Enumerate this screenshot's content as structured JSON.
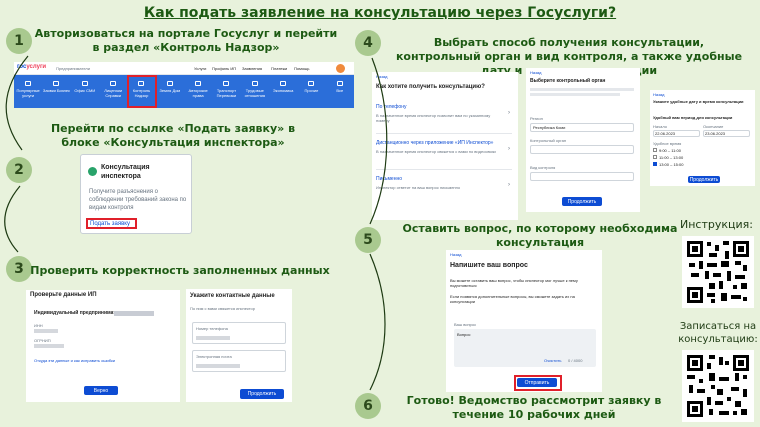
{
  "title": "Как подать заявление на консультацию через Госуслуги?",
  "steps": [
    {
      "num": "1",
      "text": "Авторизоваться на портале Госуслуг и перейти в раздел «Контроль Надзор»"
    },
    {
      "num": "2",
      "text": "Перейти по ссылке «Подать заявку» в блоке «Консультация инспектора»"
    },
    {
      "num": "3",
      "text": "Проверить корректность заполненных данных"
    },
    {
      "num": "4",
      "text": "Выбрать способ получения консультации, контрольный орган и вид контроля, а также удобные дату и время консультации"
    },
    {
      "num": "5",
      "text": "Оставить вопрос, по которому необходима консультация"
    },
    {
      "num": "6",
      "text": "Готово! Ведомство рассмотрит заявку в течение 10 рабочих дней"
    }
  ],
  "portal": {
    "logo_a": "гос",
    "logo_b": "услуги",
    "entity": "Предприниматели",
    "top_links": [
      "Услуги",
      "Профиль ИП",
      "Заявления",
      "Платежи",
      "Помощь"
    ],
    "nav": [
      "Популярные услуги",
      "Заявки Бизнес",
      "Офис СМИ",
      "Лицензии Справки",
      "Контроль Надзор",
      "Земля Дом",
      "Авторские права",
      "Транспорт Перевозки",
      "Трудовые отношения",
      "Экономика",
      "Прочие",
      "Все"
    ]
  },
  "inspector": {
    "title": "Консультация инспектора",
    "desc": "Получите разъяснения о соблюдении требований закона по видам контроля",
    "link": "Подать заявку"
  },
  "check": {
    "title": "Проверьте данные ИП",
    "name": "Индивидуальный предприниматель",
    "f1": "ИНН",
    "f2": "ОГРНИП",
    "link": "Откуда эти данные и как исправить ошибки",
    "button": "Верно"
  },
  "contacts": {
    "title": "Укажите контактные данные",
    "sub": "По ним с вами свяжется инспектор",
    "phone": "Номер телефона",
    "email": "Электронная почта",
    "button": "Продолжить"
  },
  "method": {
    "back": "Назад",
    "title": "Как хотите получить консультацию?",
    "options": [
      {
        "name": "По телефону",
        "desc": "В назначенное время инспектор позвонит вам по указанному номеру"
      },
      {
        "name": "Дистанционно через приложение «ИП Инспектор»",
        "desc": "В назначенное время инспектор свяжется с вами по видеосвязи"
      },
      {
        "name": "Письменно",
        "desc": "Инспектор ответит на ваш вопрос письменно"
      }
    ]
  },
  "organ": {
    "back": "Назад",
    "title": "Выберите контрольный орган",
    "l1": "Регион",
    "v1": "Республика Коми",
    "l2": "Контрольный орган",
    "l3": "Вид контроля",
    "button": "Продолжить"
  },
  "datetime": {
    "back": "Назад",
    "title": "Укажите удобные дату и время консультации",
    "sub": "Удобный вам период для консультации",
    "from": "Начало",
    "to": "Окончание",
    "d1": "22.06.2023",
    "d2": "23.06.2023",
    "slots_label": "Удобное время",
    "slots": [
      "9:00 – 11:00",
      "11:00 – 13:00",
      "13:00 – 15:00"
    ],
    "button": "Продолжить"
  },
  "question": {
    "back": "Назад",
    "title": "Напишите ваш вопрос",
    "p1": "Вы можете оставить ваш вопрос, чтобы инспектор мог лучше к нему подготовиться",
    "p2": "Если появятся дополнительные вопросы, вы сможете задать их на консультации",
    "label": "Ваш вопрос",
    "placeholder": "Вопрос",
    "clear": "Очистить",
    "counter": "0 / 4000",
    "button": "Отправить"
  },
  "qr1_label": "Инструкция:",
  "qr2_label": "Записаться на консультацию:",
  "colors": {
    "bg": "#e8f2dc",
    "accent": "#1d5a13",
    "portal_blue": "#0d4cd3",
    "highlight": "#e0202a"
  }
}
